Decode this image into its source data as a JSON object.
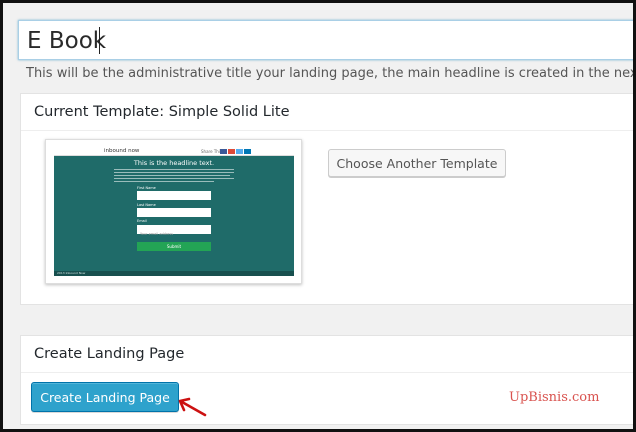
{
  "title_field": {
    "value": "E Book"
  },
  "help_text": "This will be the administrative title your landing page, the main headline is created in the next step",
  "template_box": {
    "title": "Current Template: Simple Solid Lite",
    "choose_button": "Choose Another Template",
    "preview": {
      "logo": "inbound now",
      "share_label": "Share This",
      "headline": "This is the headline text.",
      "field_labels": [
        "First Name",
        "Last Name",
        "Email"
      ],
      "email_placeholder": "Your email address",
      "submit_label": "Submit",
      "footer_text": "2013 Inbound Now",
      "background_color": "#1f6b69",
      "submit_color": "#23a455",
      "share_colors": [
        "#3b5998",
        "#dd4b39",
        "#55acee",
        "#0077b5"
      ]
    }
  },
  "create_box": {
    "title": "Create Landing Page",
    "create_button": "Create Landing Page"
  },
  "annotation": {
    "arrow_icon": "red-arrow-icon",
    "arrow_color": "#cc1111"
  },
  "watermark": "UpBisnis.com",
  "colors": {
    "primary_button": "#2ea2cc",
    "watermark": "#d9534f"
  }
}
